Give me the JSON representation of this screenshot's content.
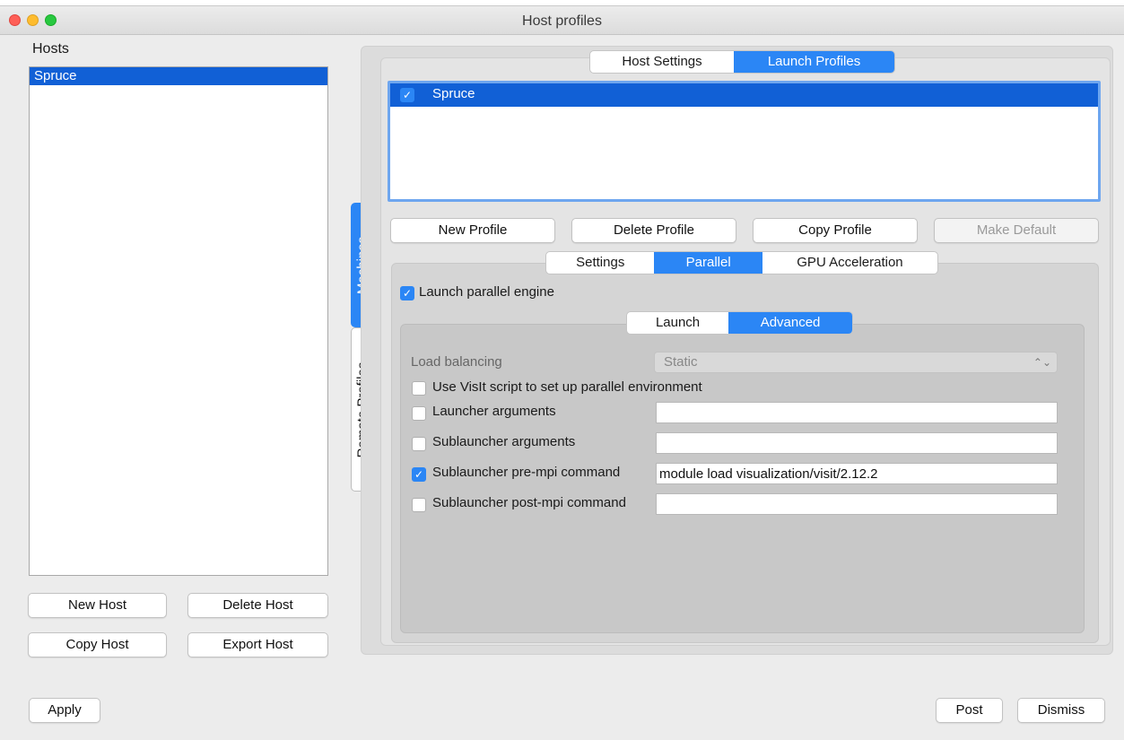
{
  "window": {
    "title": "Host profiles"
  },
  "hosts": {
    "label": "Hosts",
    "items": [
      "Spruce"
    ],
    "buttons": {
      "new": "New Host",
      "delete": "Delete Host",
      "copy": "Copy Host",
      "export": "Export Host"
    }
  },
  "side_tabs": {
    "machines": "Machines",
    "remote_profiles": "Remote Profiles"
  },
  "top_tabs": {
    "host_settings": "Host Settings",
    "launch_profiles": "Launch Profiles"
  },
  "profiles": {
    "items": [
      {
        "name": "Spruce",
        "checked": true
      }
    ],
    "buttons": {
      "new": "New Profile",
      "delete": "Delete Profile",
      "copy": "Copy Profile",
      "make_default": "Make Default"
    }
  },
  "profile_tabs": {
    "settings": "Settings",
    "parallel": "Parallel",
    "gpu": "GPU Acceleration"
  },
  "parallel": {
    "launch_engine_label": "Launch parallel engine",
    "launch_engine_checked": true,
    "subtabs": {
      "launch": "Launch",
      "advanced": "Advanced"
    }
  },
  "advanced": {
    "load_balancing_label": "Load balancing",
    "load_balancing_value": "Static",
    "use_visit_script_label": "Use VisIt script to set up parallel environment",
    "launcher_args_label": "Launcher arguments",
    "launcher_args_value": "",
    "sublauncher_args_label": "Sublauncher arguments",
    "sublauncher_args_value": "",
    "pre_mpi_label": "Sublauncher pre-mpi command",
    "pre_mpi_checked": true,
    "pre_mpi_value": "module load visualization/visit/2.12.2",
    "post_mpi_label": "Sublauncher post-mpi command",
    "post_mpi_value": ""
  },
  "footer": {
    "apply": "Apply",
    "post": "Post",
    "dismiss": "Dismiss"
  },
  "colors": {
    "accent": "#2b86f5",
    "selection": "#1160d6"
  }
}
